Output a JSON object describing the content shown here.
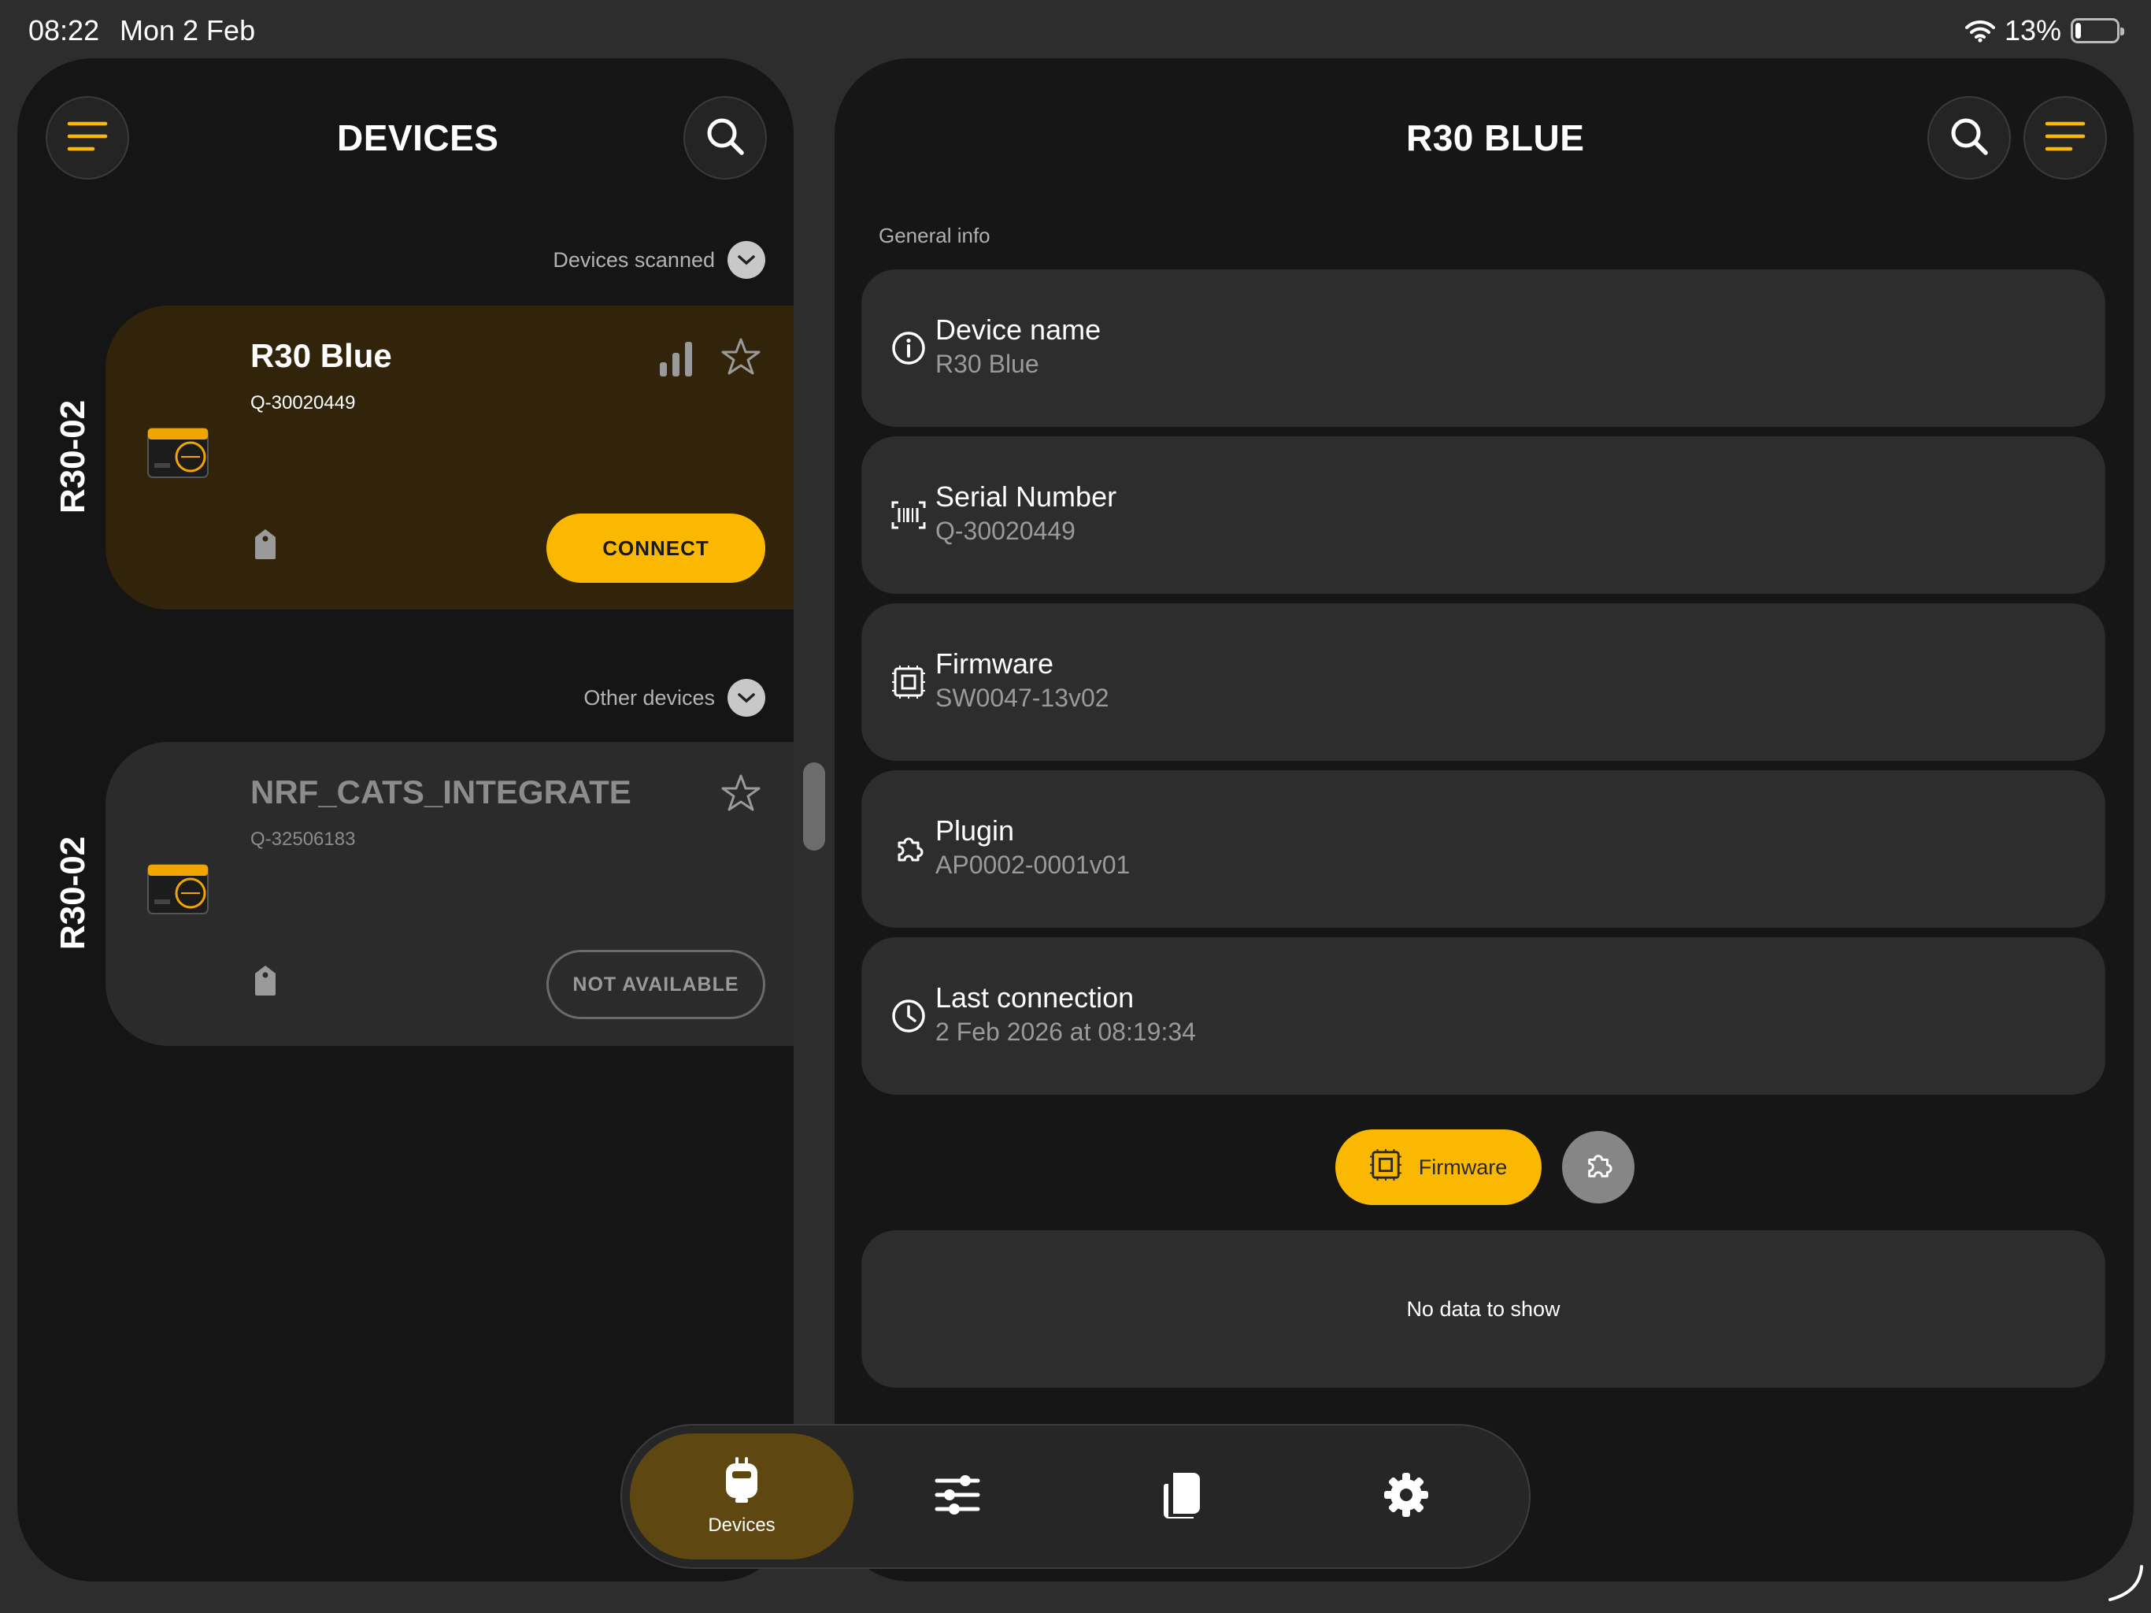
{
  "status_bar": {
    "time": "08:22",
    "date": "Mon 2 Feb",
    "battery_percent": "13%",
    "battery_level": 0.13
  },
  "left_panel": {
    "title": "DEVICES",
    "sections": {
      "scanned_label": "Devices scanned",
      "other_label": "Other devices"
    },
    "devices": [
      {
        "group_label": "R30-02",
        "name": "R30 Blue",
        "serial": "Q-30020449",
        "action_label": "CONNECT",
        "status": "active"
      },
      {
        "group_label": "R30-02",
        "name": "NRF_CATS_INTEGRATE",
        "serial": "Q-32506183",
        "action_label": "NOT AVAILABLE",
        "status": "unavailable"
      }
    ]
  },
  "right_panel": {
    "title": "R30 BLUE",
    "general_info_label": "General info",
    "info": [
      {
        "icon": "info-icon",
        "title": "Device name",
        "value": "R30 Blue"
      },
      {
        "icon": "barcode-icon",
        "title": "Serial Number",
        "value": "Q-30020449"
      },
      {
        "icon": "chip-icon",
        "title": "Firmware",
        "value": "SW0047-13v02"
      },
      {
        "icon": "puzzle-icon",
        "title": "Plugin",
        "value": "AP0002-0001v01"
      },
      {
        "icon": "clock-icon",
        "title": "Last connection",
        "value": "2 Feb 2026 at 08:19:34"
      }
    ],
    "firmware_button_label": "Firmware",
    "no_data_text": "No data to show"
  },
  "tabbar": {
    "tabs": [
      {
        "icon": "device-icon",
        "label": "Devices",
        "active": true
      },
      {
        "icon": "sliders-icon",
        "label": "",
        "active": false
      },
      {
        "icon": "docs-icon",
        "label": "",
        "active": false
      },
      {
        "icon": "gear-icon",
        "label": "",
        "active": false
      }
    ]
  },
  "colors": {
    "accent": "#fbb800",
    "panel_bg": "#151515",
    "card_bg": "#2d2d2d",
    "active_card_bg": "#32240b"
  }
}
